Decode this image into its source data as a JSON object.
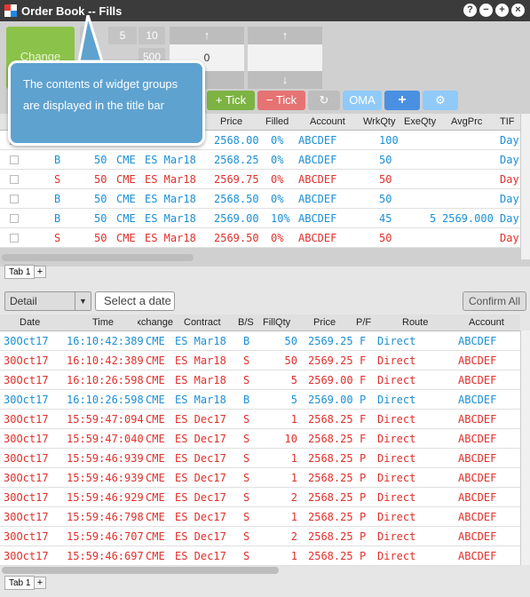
{
  "window": {
    "title": "Order Book -- Fills"
  },
  "titlebar_icons": [
    "?",
    "−",
    "+",
    "×"
  ],
  "top": {
    "change_label": "Change",
    "qty_presets": [
      "5",
      "10",
      "",
      "500"
    ],
    "spinner_value": "0",
    "buttons": {
      "plus_tick": "Tick",
      "minus_tick": "Tick",
      "oma": "OMA",
      "plus": "+"
    }
  },
  "tooltip": {
    "text": "The contents of widget groups are displayed in the title bar"
  },
  "orders": {
    "headers": {
      "price": "Price",
      "filled": "Filled",
      "account": "Account",
      "wrkqty": "WrkQty",
      "exeqty": "ExeQty",
      "avgprc": "AvgPrc",
      "tif": "TIF"
    },
    "rows": [
      {
        "side": "",
        "qty": "",
        "exch": "",
        "contract": "",
        "price": "2568.00",
        "filled": "0%",
        "account": "ABCDEF",
        "wrk": "100",
        "exe": "",
        "avg": "",
        "tif": "Day",
        "color": "#1a8fd6"
      },
      {
        "side": "B",
        "qty": "50",
        "exch": "CME",
        "contract": "ES Mar18",
        "price": "2568.25",
        "filled": "0%",
        "account": "ABCDEF",
        "wrk": "50",
        "exe": "",
        "avg": "",
        "tif": "Day",
        "color": "#1a8fd6"
      },
      {
        "side": "S",
        "qty": "50",
        "exch": "CME",
        "contract": "ES Mar18",
        "price": "2569.75",
        "filled": "0%",
        "account": "ABCDEF",
        "wrk": "50",
        "exe": "",
        "avg": "",
        "tif": "Day",
        "color": "#e0302b"
      },
      {
        "side": "B",
        "qty": "50",
        "exch": "CME",
        "contract": "ES Mar18",
        "price": "2568.50",
        "filled": "0%",
        "account": "ABCDEF",
        "wrk": "50",
        "exe": "",
        "avg": "",
        "tif": "Day",
        "color": "#1a8fd6"
      },
      {
        "side": "B",
        "qty": "50",
        "exch": "CME",
        "contract": "ES Mar18",
        "price": "2569.00",
        "filled": "10%",
        "account": "ABCDEF",
        "wrk": "45",
        "exe": "5",
        "avg": "2569.000",
        "tif": "Day",
        "color": "#1a8fd6"
      },
      {
        "side": "S",
        "qty": "50",
        "exch": "CME",
        "contract": "ES Mar18",
        "price": "2569.50",
        "filled": "0%",
        "account": "ABCDEF",
        "wrk": "50",
        "exe": "",
        "avg": "",
        "tif": "Day",
        "color": "#e0302b"
      }
    ]
  },
  "tabs_top": [
    "Tab 1"
  ],
  "fills_toolbar": {
    "view": "Detail",
    "date_placeholder": "Select a date",
    "confirm_all": "Confirm All"
  },
  "fills": {
    "headers": {
      "date": "Date",
      "time": "Time",
      "exchange": "Exchange",
      "contract": "Contract",
      "bs": "B/S",
      "fillqty": "FillQty",
      "price": "Price",
      "pf": "P/F",
      "route": "Route",
      "account": "Account"
    },
    "rows": [
      {
        "date": "30Oct17",
        "time": "16:10:42:389",
        "exch": "CME",
        "contract": "ES Mar18",
        "bs": "B",
        "qty": "50",
        "price": "2569.25",
        "pf": "F",
        "route": "Direct",
        "account": "ABCDEF",
        "color": "#1a8fd6"
      },
      {
        "date": "30Oct17",
        "time": "16:10:42:389",
        "exch": "CME",
        "contract": "ES Mar18",
        "bs": "S",
        "qty": "50",
        "price": "2569.25",
        "pf": "F",
        "route": "Direct",
        "account": "ABCDEF",
        "color": "#e0302b"
      },
      {
        "date": "30Oct17",
        "time": "16:10:26:598",
        "exch": "CME",
        "contract": "ES Mar18",
        "bs": "S",
        "qty": "5",
        "price": "2569.00",
        "pf": "F",
        "route": "Direct",
        "account": "ABCDEF",
        "color": "#e0302b"
      },
      {
        "date": "30Oct17",
        "time": "16:10:26:598",
        "exch": "CME",
        "contract": "ES Mar18",
        "bs": "B",
        "qty": "5",
        "price": "2569.00",
        "pf": "P",
        "route": "Direct",
        "account": "ABCDEF",
        "color": "#1a8fd6"
      },
      {
        "date": "30Oct17",
        "time": "15:59:47:094",
        "exch": "CME",
        "contract": "ES Dec17",
        "bs": "S",
        "qty": "1",
        "price": "2568.25",
        "pf": "F",
        "route": "Direct",
        "account": "ABCDEF",
        "color": "#e0302b"
      },
      {
        "date": "30Oct17",
        "time": "15:59:47:040",
        "exch": "CME",
        "contract": "ES Dec17",
        "bs": "S",
        "qty": "10",
        "price": "2568.25",
        "pf": "F",
        "route": "Direct",
        "account": "ABCDEF",
        "color": "#e0302b"
      },
      {
        "date": "30Oct17",
        "time": "15:59:46:939",
        "exch": "CME",
        "contract": "ES Dec17",
        "bs": "S",
        "qty": "1",
        "price": "2568.25",
        "pf": "P",
        "route": "Direct",
        "account": "ABCDEF",
        "color": "#e0302b"
      },
      {
        "date": "30Oct17",
        "time": "15:59:46:939",
        "exch": "CME",
        "contract": "ES Dec17",
        "bs": "S",
        "qty": "1",
        "price": "2568.25",
        "pf": "P",
        "route": "Direct",
        "account": "ABCDEF",
        "color": "#e0302b"
      },
      {
        "date": "30Oct17",
        "time": "15:59:46:929",
        "exch": "CME",
        "contract": "ES Dec17",
        "bs": "S",
        "qty": "2",
        "price": "2568.25",
        "pf": "P",
        "route": "Direct",
        "account": "ABCDEF",
        "color": "#e0302b"
      },
      {
        "date": "30Oct17",
        "time": "15:59:46:798",
        "exch": "CME",
        "contract": "ES Dec17",
        "bs": "S",
        "qty": "1",
        "price": "2568.25",
        "pf": "P",
        "route": "Direct",
        "account": "ABCDEF",
        "color": "#e0302b"
      },
      {
        "date": "30Oct17",
        "time": "15:59:46:707",
        "exch": "CME",
        "contract": "ES Dec17",
        "bs": "S",
        "qty": "2",
        "price": "2568.25",
        "pf": "P",
        "route": "Direct",
        "account": "ABCDEF",
        "color": "#e0302b"
      },
      {
        "date": "30Oct17",
        "time": "15:59:46:697",
        "exch": "CME",
        "contract": "ES Dec17",
        "bs": "S",
        "qty": "1",
        "price": "2568.25",
        "pf": "P",
        "route": "Direct",
        "account": "ABCDEF",
        "color": "#e0302b"
      }
    ]
  },
  "tabs_bottom": [
    "Tab 1"
  ],
  "colors": {
    "buy": "#1a8fd6",
    "sell": "#e0302b",
    "change": "#8bc34a",
    "tick_up": "#7cb342",
    "tick_down": "#e57373",
    "oma": "#90caf9",
    "plus": "#4a90e2",
    "tooltip": "#5ea2d0"
  }
}
